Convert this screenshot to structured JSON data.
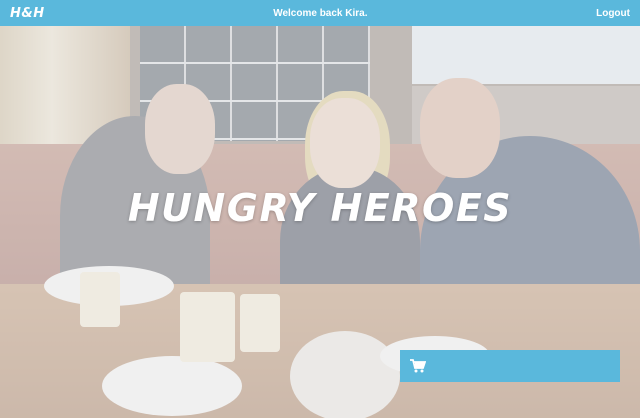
{
  "header": {
    "logo": "H&H",
    "welcome": "Welcome back Kira.",
    "logout": "Logout"
  },
  "hero": {
    "title": "HUNGRY HEROES"
  },
  "cart": {
    "icon": "shopping-cart-icon"
  },
  "colors": {
    "accent": "#5ab8dc",
    "text_on_accent": "#ffffff"
  }
}
